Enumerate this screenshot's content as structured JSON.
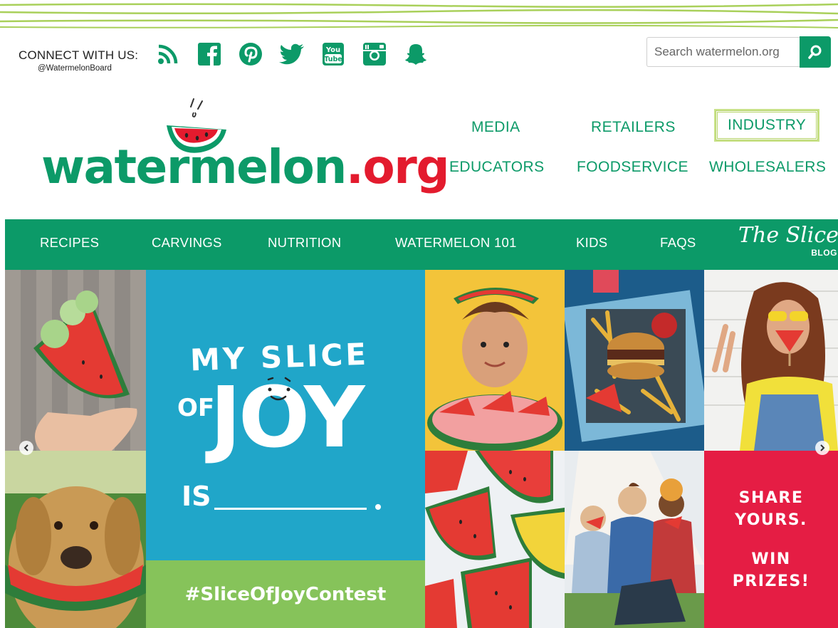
{
  "colors": {
    "brand_green": "#0c9a68",
    "brand_red": "#e31b2e",
    "stripe_green": "#a9d05a",
    "contest_blue": "#20a6c9",
    "hashtag_green": "#86c35a",
    "share_red": "#e51d44"
  },
  "connect": {
    "label": "CONNECT WITH US:",
    "handle": "@WatermelonBoard",
    "icons": [
      "rss-icon",
      "facebook-icon",
      "pinterest-icon",
      "twitter-icon",
      "youtube-icon",
      "instagram-icon",
      "snapchat-icon"
    ]
  },
  "search": {
    "placeholder": "Search watermelon.org",
    "button_icon": "search-icon"
  },
  "logo": {
    "text_main": "watermelon",
    "text_tld": ".org"
  },
  "audience_nav": {
    "row1": [
      "MEDIA",
      "RETAILERS",
      "INDUSTRY"
    ],
    "row2": [
      "EDUCATORS",
      "FOODSERVICE",
      "WHOLESALERS"
    ]
  },
  "main_nav": {
    "items": [
      "RECIPES",
      "CARVINGS",
      "NUTRITION",
      "WATERMELON 101",
      "KIDS",
      "FAQS"
    ],
    "blog_script": "The Slice",
    "blog_sub": "BLOG"
  },
  "hero": {
    "contest_line1": "MY SLICE",
    "contest_of": "OF",
    "contest_joy": "JOY",
    "contest_is": "IS",
    "hashtag": "#SliceOfJoyContest",
    "share_line1": "SHARE",
    "share_line2": "YOURS.",
    "share_line3": "WIN",
    "share_line4": "PRIZES!",
    "carousel_prev_icon": "chevron-left-icon",
    "carousel_next_icon": "chevron-right-icon"
  }
}
